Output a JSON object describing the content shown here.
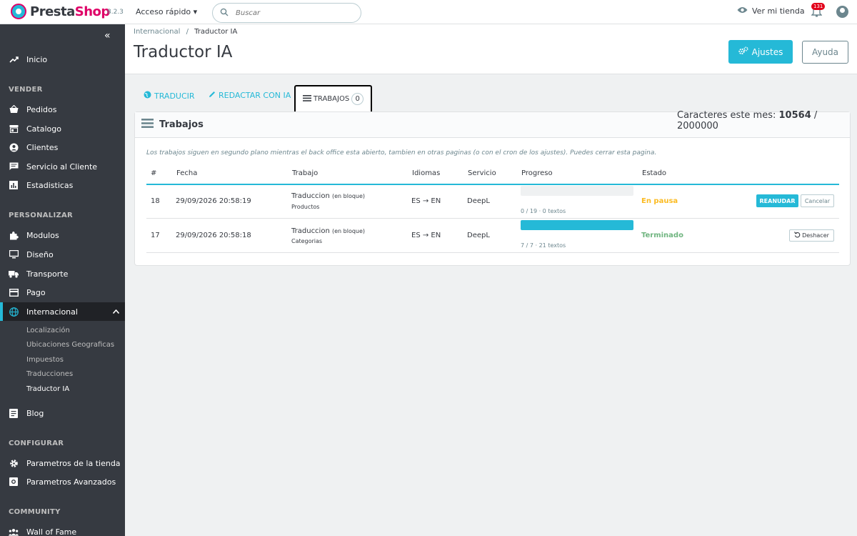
{
  "header": {
    "logo_prefix": "Presta",
    "logo_suffix": "Shop",
    "version": "8.2.3",
    "quick_access": "Acceso rápido",
    "search_placeholder": "Buscar",
    "view_shop": "Ver mi tienda",
    "notifications": "131"
  },
  "sidebar": {
    "home": "Inicio",
    "sections": {
      "vender": "VENDER",
      "personalizar": "PERSONALIZAR",
      "configurar": "CONFIGURAR",
      "community": "COMMUNITY"
    },
    "vender_items": [
      "Pedidos",
      "Catalogo",
      "Clientes",
      "Servicio al Cliente",
      "Estadisticas"
    ],
    "personalizar_items": [
      "Modulos",
      "Diseño",
      "Transporte",
      "Pago",
      "Internacional"
    ],
    "internacional_sub": [
      "Localización",
      "Ubicaciones Geograficas",
      "Impuestos",
      "Traducciones",
      "Traductor IA"
    ],
    "blog": "Blog",
    "configurar_items": [
      "Parametros de la tienda",
      "Parametros Avanzados"
    ],
    "community_items": [
      "Wall of Fame"
    ]
  },
  "page": {
    "breadcrumb_parent": "Internacional",
    "breadcrumb_sep": "/",
    "breadcrumb_current": "Traductor IA",
    "title": "Traductor IA",
    "btn_ajustes": "Ajustes",
    "btn_ayuda": "Ayuda"
  },
  "tabs": {
    "traducir": "TRADUCIR",
    "redactar": "REDACTAR CON IA",
    "trabajos": "TRABAJOS",
    "trabajos_count": "0"
  },
  "usage": {
    "label": "Caracteres este mes:",
    "used": "10564",
    "sep": "/",
    "total": "2000000"
  },
  "card": {
    "title": "Trabajos",
    "note": "Los trabajos siguen en segundo plano mientras el back office esta abierto, tambien en otras paginas (o con el cron de los ajustes). Puedes cerrar esta pagina."
  },
  "table": {
    "headers": [
      "#",
      "Fecha",
      "Trabajo",
      "Idiomas",
      "Servicio",
      "Progreso",
      "Estado"
    ],
    "rows": [
      {
        "id": "18",
        "date": "29/09/2026 20:58:19",
        "job": "Traduccion",
        "job_mode": "(en bloque)",
        "job_target": "Productos",
        "langs": "ES → EN",
        "service": "DeepL",
        "progress": 0,
        "progress_text": "0 / 19 · 0 textos",
        "status": "En pausa",
        "action_primary": "REANUDAR",
        "action_secondary": "Cancelar"
      },
      {
        "id": "17",
        "date": "29/09/2026 20:58:18",
        "job": "Traduccion",
        "job_mode": "(en bloque)",
        "job_target": "Categorias",
        "langs": "ES → EN",
        "service": "DeepL",
        "progress": 1,
        "progress_text": "7 / 7 · 21 textos",
        "status": "Terminado",
        "action_primary": "Deshacer"
      }
    ]
  },
  "colors": {
    "accent": "#25b9d7",
    "sidebar": "#363a41",
    "paused": "#fbbb22",
    "done": "#70b580"
  }
}
